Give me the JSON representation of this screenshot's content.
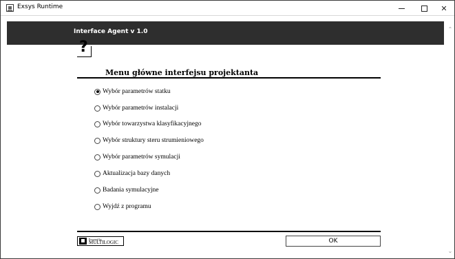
{
  "window": {
    "title": "Exsys Runtime",
    "controls": {
      "minimize": "minimize",
      "maximize": "maximize",
      "close": "✕"
    }
  },
  "header": {
    "title": "Interface Agent v 1.0"
  },
  "menu": {
    "icon": "question-mark-icon",
    "icon_glyph": "?",
    "title": "Menu główne interfejsu projektanta",
    "options": [
      {
        "label": "Wybór parametrów statku",
        "checked": true
      },
      {
        "label": "Wybór parametrów instalacji",
        "checked": false
      },
      {
        "label": "Wybór towarzystwa klasyfikacyjnego",
        "checked": false
      },
      {
        "label": "Wybór struktury steru strumieniowego",
        "checked": false
      },
      {
        "label": "Wybór parametrów symulacji",
        "checked": false
      },
      {
        "label": "Aktualizacja bazy danych",
        "checked": false
      },
      {
        "label": "Badania symulacyjne",
        "checked": false
      },
      {
        "label": "Wyjdź z programu",
        "checked": false
      }
    ]
  },
  "footer": {
    "logo_small": "Powered by",
    "logo_big": "MULTILOGIC",
    "ok_label": "OK"
  },
  "scrollbar": {
    "up": "⌃",
    "down": "⌄"
  }
}
